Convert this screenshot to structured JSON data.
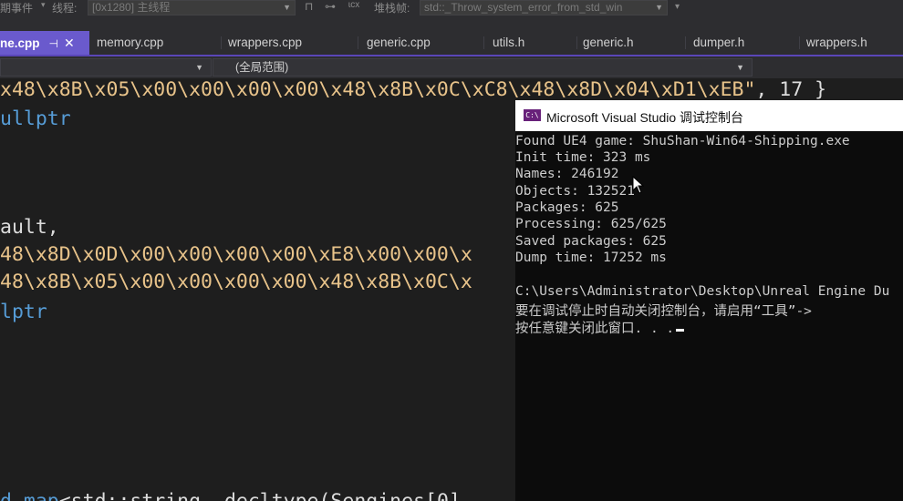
{
  "toolbar": {
    "lifecycle_label": "期事件",
    "lifecycle_arrow": "▾",
    "thread_label": "线程:",
    "thread_value": "[0x1280] 主线程",
    "stack_label": "堆栈帧:",
    "stack_value": "std::_Throw_system_error_from_std_win"
  },
  "tabs": {
    "active": {
      "label": "ne.cpp",
      "pin": "⊣",
      "close": "✕"
    },
    "items": [
      {
        "label": "memory.cpp"
      },
      {
        "label": "wrappers.cpp"
      },
      {
        "label": "generic.cpp"
      },
      {
        "label": "utils.h"
      },
      {
        "label": "generic.h"
      },
      {
        "label": "dumper.h"
      },
      {
        "label": "wrappers.h"
      }
    ]
  },
  "navbar": {
    "scope_label": "(全局范围)"
  },
  "code": {
    "line1_str": "x48\\x8B\\x05\\x00\\x00\\x00\\x00\\x48\\x8B\\x0C\\xC8\\x48\\x8D\\x04\\xD1\\xEB\"",
    "line1_rest": ", 17 }",
    "line2": "ullptr",
    "line3": "ault,",
    "line4": "48\\x8D\\x0D\\x00\\x00\\x00\\x00\\xE8\\x00\\x00\\x",
    "line5": "48\\x8B\\x05\\x00\\x00\\x00\\x00\\x48\\x8B\\x0C\\x",
    "line6": "lptr",
    "line7_kw": "d map",
    "line7_rest": "<std::string, decltype(Sengines[0]"
  },
  "console": {
    "title": "Microsoft Visual Studio 调试控制台",
    "icon_text": "C:\\",
    "lines": [
      "Found UE4 game: ShuShan-Win64-Shipping.exe",
      "Init time: 323 ms",
      "Names: 246192",
      "Objects: 132521",
      "Packages: 625",
      "Processing: 625/625",
      "Saved packages: 625",
      "Dump time: 17252 ms",
      "",
      "C:\\Users\\Administrator\\Desktop\\Unreal Engine Du",
      "要在调试停止时自动关闭控制台，请启用“工具”->",
      "按任意键关闭此窗口. . ."
    ]
  },
  "colors": {
    "accent": "#6a5acd",
    "string": "#e8c38a",
    "keyword": "#569cd6",
    "console_bg": "#0c0c0c"
  }
}
